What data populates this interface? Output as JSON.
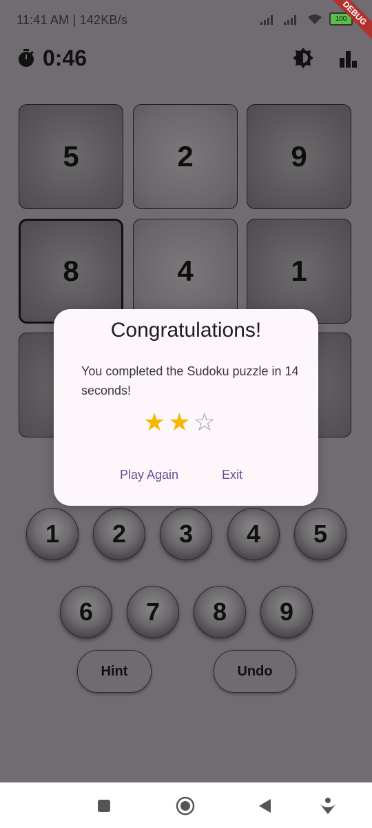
{
  "status_bar": {
    "time_text": "11:41 AM | 142KB/s",
    "battery_text": "100",
    "debug_label": "DEBUG"
  },
  "toolbar": {
    "timer": "0:46",
    "icons": [
      "timer-icon",
      "brightness-icon",
      "leaderboard-icon"
    ]
  },
  "grid": {
    "cells": [
      {
        "value": "5"
      },
      {
        "value": "2"
      },
      {
        "value": "9"
      },
      {
        "value": "8"
      },
      {
        "value": "4"
      },
      {
        "value": "1"
      },
      {
        "value": ""
      },
      {
        "value": ""
      },
      {
        "value": ""
      }
    ]
  },
  "dialog": {
    "title": "Congratulations!",
    "body": "You completed the Sudoku puzzle in 14 seconds!",
    "rating": 2,
    "max_rating": 5,
    "stars_shown": 3,
    "play_again_label": "Play Again",
    "exit_label": "Exit"
  },
  "numpad": {
    "row1": [
      "1",
      "2",
      "3",
      "4",
      "5"
    ],
    "row2": [
      "6",
      "7",
      "8",
      "9"
    ]
  },
  "actions": {
    "hint_label": "Hint",
    "undo_label": "Undo"
  },
  "colors": {
    "scrim": "#716c72",
    "dialog_bg": "#fdf6fb",
    "accent": "#6a4e9b",
    "star_filled": "#f5b700"
  }
}
